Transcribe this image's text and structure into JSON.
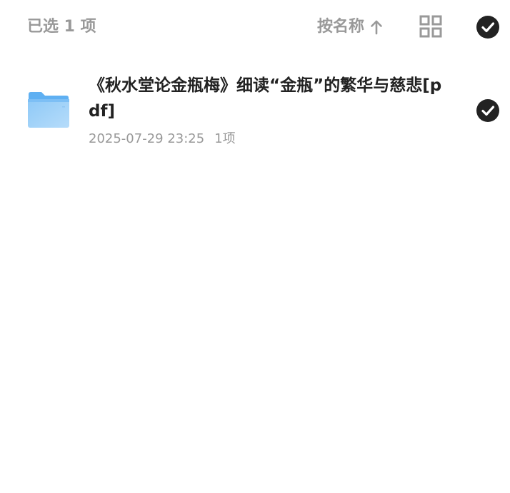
{
  "toolbar": {
    "selected_count": "已选 1 项",
    "sort_label": "按名称",
    "sort_icon": "arrow-up-icon",
    "view_icon": "grid-view-icon",
    "select_all_icon": "check-circle-icon"
  },
  "files": [
    {
      "name": "《秋水堂论金瓶梅》细读“金瓶”的繁华与慈悲[pdf]",
      "date": "2025-07-29 23:25",
      "count": "1项",
      "icon": "folder-icon",
      "selected": true
    }
  ],
  "colors": {
    "text_primary": "#222222",
    "text_secondary": "#999999",
    "check_fill": "#222222",
    "folder_blue": "#5fb0f2"
  }
}
